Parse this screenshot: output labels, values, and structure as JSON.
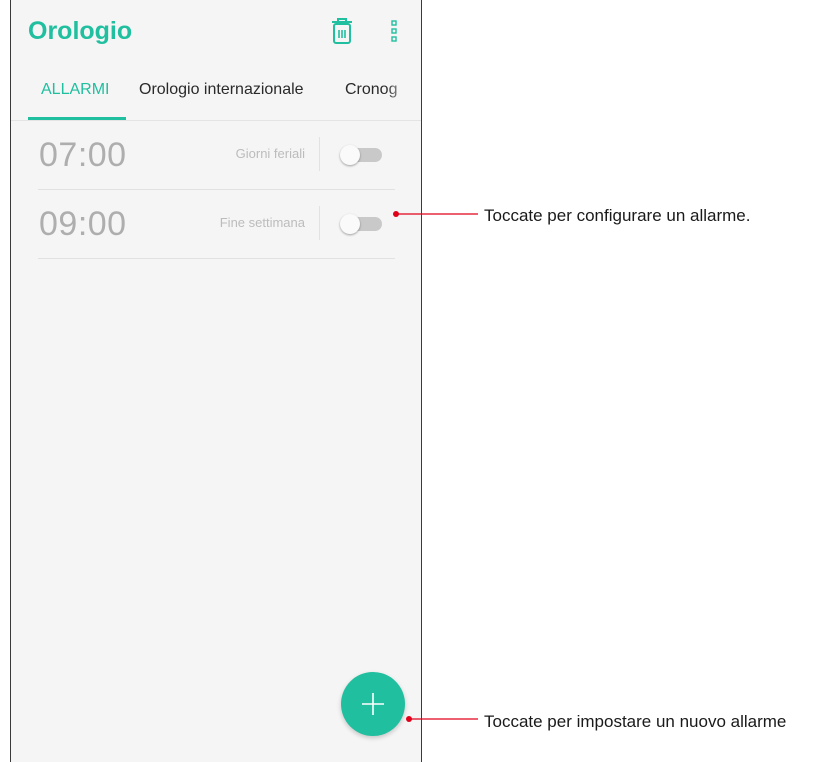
{
  "app": {
    "title": "Orologio"
  },
  "toolbar": {
    "delete_icon": "trash-icon",
    "more_icon": "more-vertical-icon"
  },
  "tabs": [
    {
      "label": "ALLARMI",
      "active": true
    },
    {
      "label": "Orologio internazionale",
      "active": false
    },
    {
      "label": "Cronog",
      "active": false
    }
  ],
  "alarms": [
    {
      "time": "07:00",
      "label": "Giorni feriali",
      "enabled": false
    },
    {
      "time": "09:00",
      "label": "Fine settimana",
      "enabled": false
    }
  ],
  "fab": {
    "icon": "plus-icon"
  },
  "annotations": [
    {
      "text": "Toccate per configurare un allarme."
    },
    {
      "text": "Toccate per impostare un nuovo allarme"
    }
  ],
  "colors": {
    "accent": "#1fbf9f",
    "callout_line": "#e0001a",
    "background": "#f5f5f5"
  }
}
